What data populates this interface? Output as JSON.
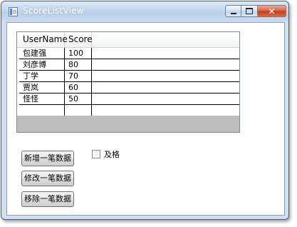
{
  "window": {
    "title": "ScoreListView"
  },
  "listview": {
    "columns": [
      "UserName",
      "Score"
    ],
    "rows": [
      {
        "name": "包建强",
        "score": "100"
      },
      {
        "name": "刘彦博",
        "score": "80"
      },
      {
        "name": "丁学",
        "score": "70"
      },
      {
        "name": "贾岚",
        "score": "60"
      },
      {
        "name": "怪怪",
        "score": "50"
      },
      {
        "name": "",
        "score": ""
      }
    ]
  },
  "buttons": {
    "add": "新增一笔数据",
    "edit": "修改一笔数据",
    "remove": "移除一笔数据"
  },
  "checkbox": {
    "label": "及格",
    "checked": false
  },
  "colors": {
    "close_button": "#c23d18",
    "empty_area": "#bdbdbd"
  },
  "icons": [
    "app-icon",
    "minimize-icon",
    "maximize-icon",
    "close-icon"
  ]
}
